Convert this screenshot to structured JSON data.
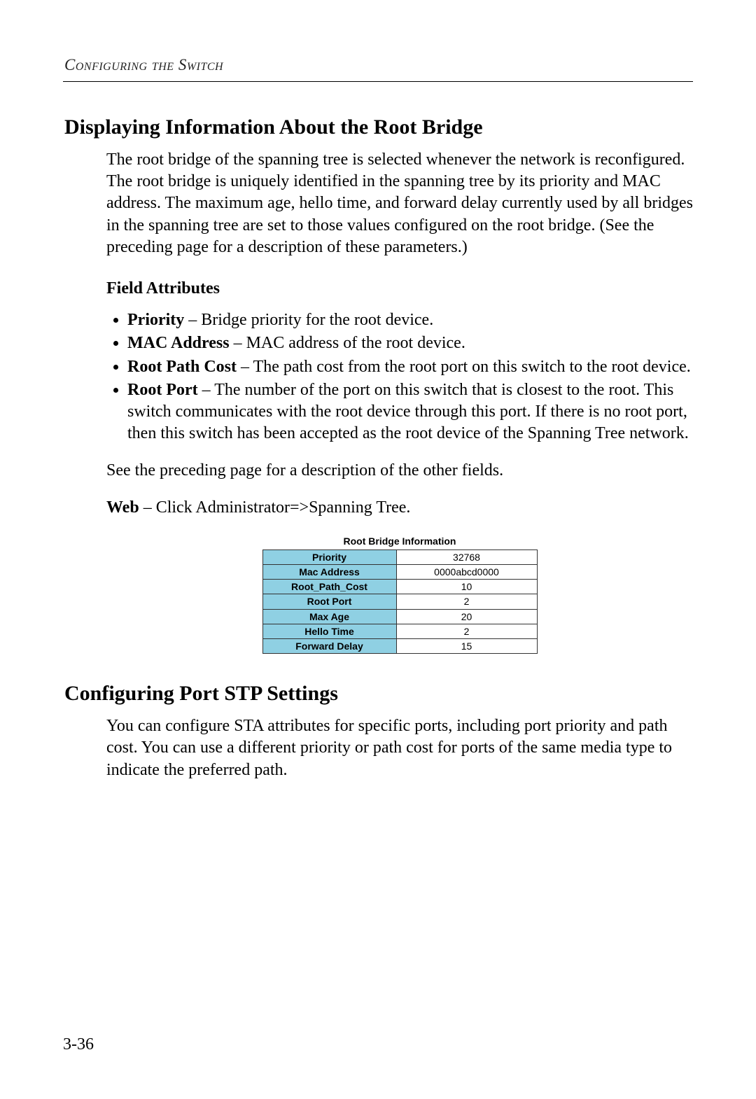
{
  "running_head": "Configuring the Switch",
  "section1": {
    "title": "Displaying Information About the Root Bridge",
    "intro": "The root bridge of the spanning tree is selected whenever the network is reconfigured. The root bridge is uniquely identified in the spanning tree by its priority and MAC address. The maximum age, hello time, and forward delay currently used by all bridges in the spanning tree are set to those values configured on the root bridge. (See the preceding page for a description of these parameters.)",
    "field_attributes_label": "Field Attributes",
    "attrs": [
      {
        "term": "Priority",
        "desc": " – Bridge priority for the root device."
      },
      {
        "term": "MAC Address",
        "desc": " – MAC address of the root device."
      },
      {
        "term": "Root Path Cost",
        "desc": " – The path cost from the root port on this switch to the root device."
      },
      {
        "term": "Root Port",
        "desc": " – The number of the port on this switch that is closest to the root. This switch communicates with the root device through this port. If there is no root port, then this switch has been accepted as the root device of the Spanning Tree network."
      }
    ],
    "see_preceding": "See the preceding page for a description of the other fields.",
    "web_lead": "Web",
    "web_rest": " – Click Administrator=>Spanning Tree."
  },
  "table": {
    "caption": "Root Bridge Information",
    "rows": [
      {
        "key": "Priority",
        "val": "32768"
      },
      {
        "key": "Mac Address",
        "val": "0000abcd0000"
      },
      {
        "key": "Root_Path_Cost",
        "val": "10"
      },
      {
        "key": "Root Port",
        "val": "2"
      },
      {
        "key": "Max Age",
        "val": "20"
      },
      {
        "key": "Hello Time",
        "val": "2"
      },
      {
        "key": "Forward Delay",
        "val": "15"
      }
    ]
  },
  "section2": {
    "title": "Configuring Port STP Settings",
    "intro": "You can configure STA attributes for specific ports, including port priority and path cost. You can use a different priority or path cost for ports of the same media type to indicate the preferred path."
  },
  "page_number": "3-36"
}
